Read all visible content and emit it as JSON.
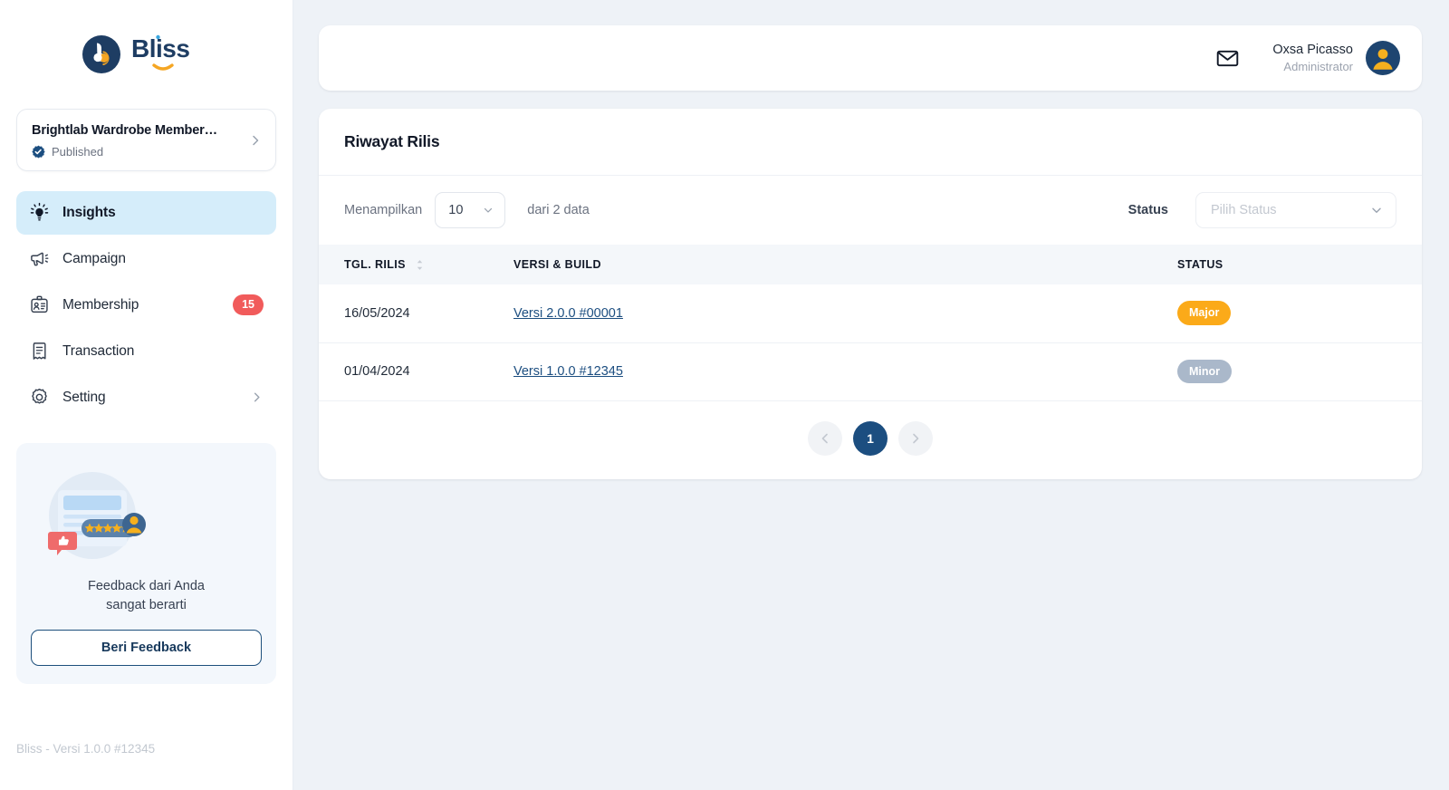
{
  "brand": {
    "name": "Bliss",
    "logo_icon": "bliss-logo-icon",
    "footer": "Bliss - Versi 1.0.0 #12345"
  },
  "sidebar": {
    "project": {
      "title": "Brightlab Wardrobe Member…",
      "status": "Published",
      "status_icon": "verified-badge-icon",
      "chevron_icon": "chevron-right-icon"
    },
    "items": [
      {
        "label": "Insights",
        "icon": "lightbulb-icon",
        "active": true,
        "badge": "",
        "chevron": false
      },
      {
        "label": "Campaign",
        "icon": "megaphone-icon",
        "active": false,
        "badge": "",
        "chevron": false
      },
      {
        "label": "Membership",
        "icon": "id-card-icon",
        "active": false,
        "badge": "15",
        "chevron": false
      },
      {
        "label": "Transaction",
        "icon": "receipt-icon",
        "active": false,
        "badge": "",
        "chevron": false
      },
      {
        "label": "Setting",
        "icon": "gear-icon",
        "active": false,
        "badge": "",
        "chevron": true
      }
    ],
    "feedback": {
      "illustration_icon": "feedback-review-illustration",
      "text_line1": "Feedback dari Anda",
      "text_line2": "sangat berarti",
      "button_label": "Beri Feedback"
    }
  },
  "topbar": {
    "mail_icon": "mail-envelope-icon",
    "user_name": "Oxsa Picasso",
    "user_role": "Administrator",
    "avatar_icon": "user-avatar-icon"
  },
  "main": {
    "title": "Riwayat Rilis",
    "filters": {
      "show_label": "Menampilkan",
      "page_size": "10",
      "count_text": "dari 2 data",
      "status_label": "Status",
      "status_placeholder": "Pilih Status",
      "caret_icon": "chevron-down-icon"
    },
    "table": {
      "columns": [
        {
          "label": "TGL. RILIS",
          "sortable": true,
          "sort_icon": "sort-updown-icon"
        },
        {
          "label": "VERSI & BUILD",
          "sortable": false
        },
        {
          "label": "STATUS",
          "sortable": false
        }
      ],
      "rows": [
        {
          "date": "16/05/2024",
          "version": "Versi 2.0.0 #00001",
          "status": "Major",
          "status_color": "#fbaa19"
        },
        {
          "date": "01/04/2024",
          "version": "Versi 1.0.0 #12345",
          "status": "Minor",
          "status_color": "#aab8ca"
        }
      ]
    },
    "pagination": {
      "prev_icon": "chevron-left-icon",
      "next_icon": "chevron-right-icon",
      "pages": [
        "1"
      ],
      "current": "1"
    }
  },
  "colors": {
    "accent_navy": "#1c4e80",
    "active_nav_bg": "#d5edfa",
    "badge_red": "#f15b5b",
    "major_orange": "#fbaa19",
    "minor_grey": "#aab8ca",
    "page_bg": "#eef2f7"
  }
}
